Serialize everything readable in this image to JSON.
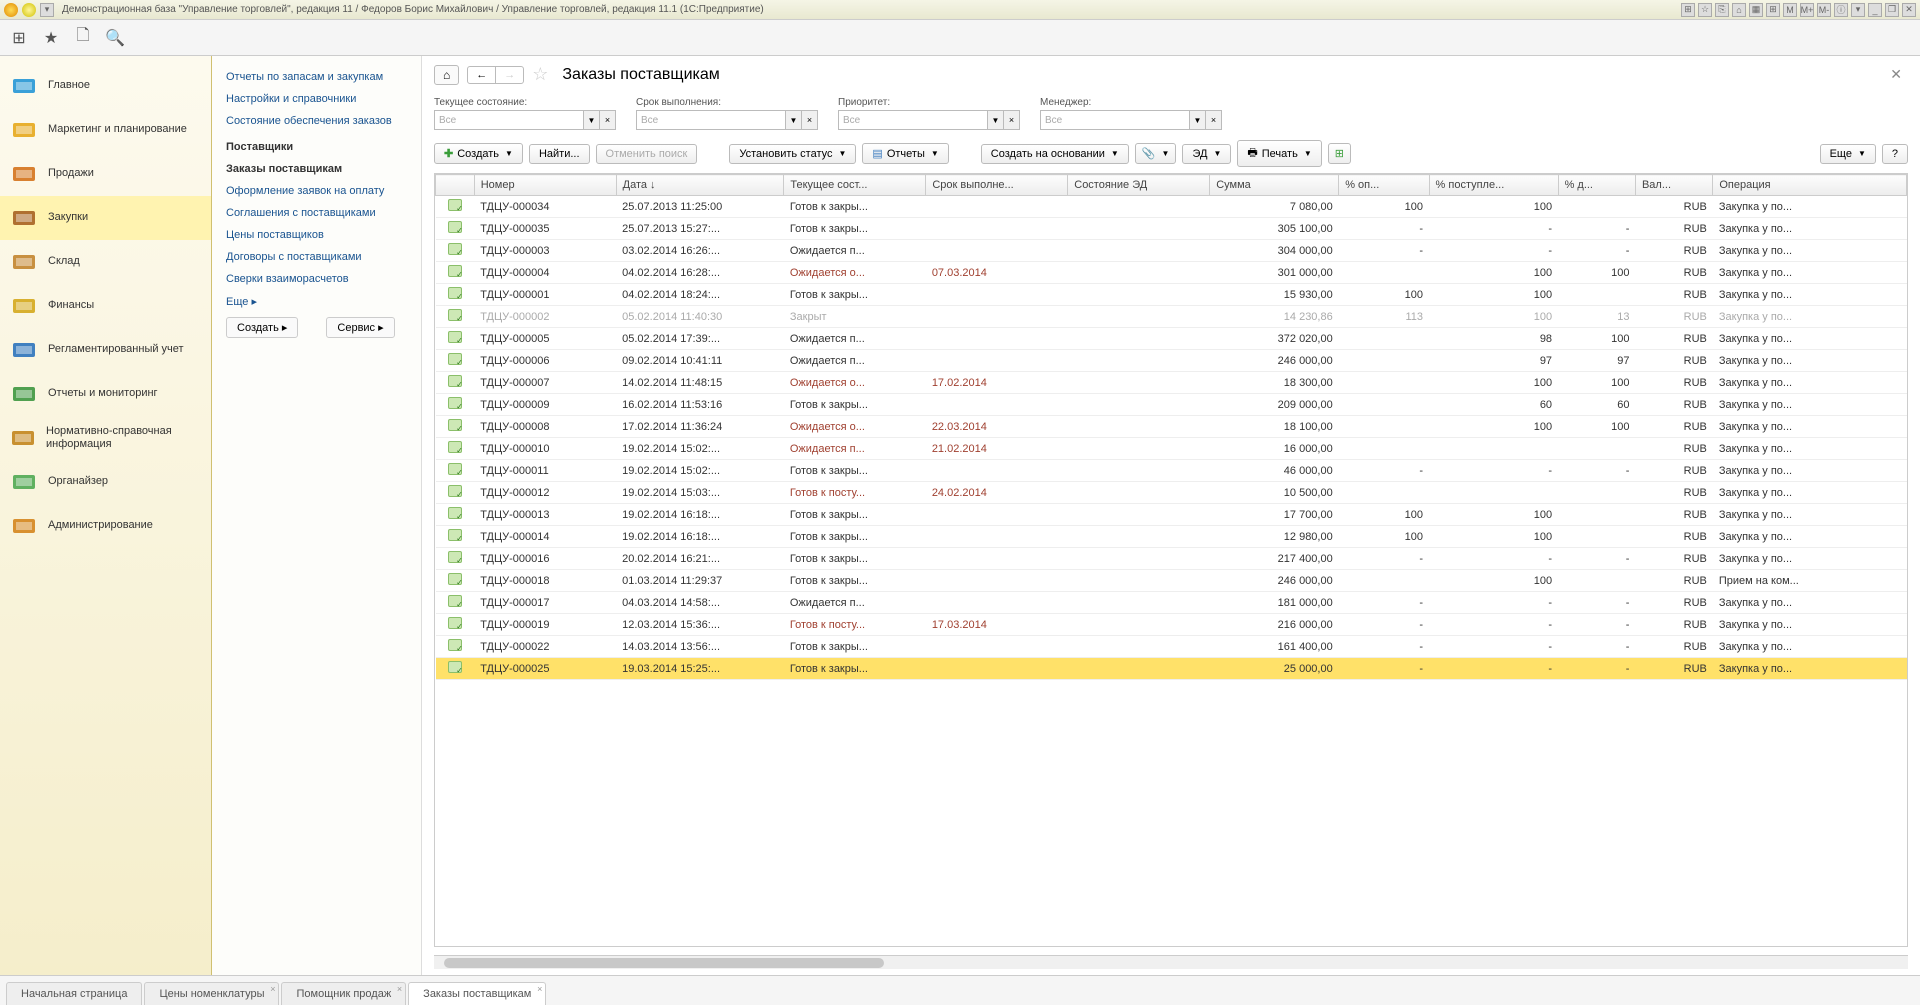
{
  "titlebar": {
    "text": "Демонстрационная база \"Управление торговлей\", редакция 11 / Федоров Борис Михайлович / Управление торговлей, редакция 11.1  (1С:Предприятие)",
    "right_icons": [
      "⊞",
      "☆",
      "⎘",
      "⌂",
      "▦",
      "⊞",
      "M",
      "M+",
      "M-",
      "ⓘ",
      "▾",
      "_",
      "❐",
      "✕"
    ]
  },
  "leftnav": [
    {
      "label": "Главное",
      "icon": "main"
    },
    {
      "label": "Маркетинг и планирование",
      "icon": "marketing"
    },
    {
      "label": "Продажи",
      "icon": "sales"
    },
    {
      "label": "Закупки",
      "icon": "purchases",
      "selected": true
    },
    {
      "label": "Склад",
      "icon": "warehouse"
    },
    {
      "label": "Финансы",
      "icon": "finance"
    },
    {
      "label": "Регламентированный учет",
      "icon": "accounting"
    },
    {
      "label": "Отчеты и мониторинг",
      "icon": "reports"
    },
    {
      "label": "Нормативно-справочная информация",
      "icon": "refinfo"
    },
    {
      "label": "Органайзер",
      "icon": "organizer"
    },
    {
      "label": "Администрирование",
      "icon": "admin"
    }
  ],
  "subnav": {
    "links": [
      {
        "text": "Отчеты по запасам и закупкам",
        "type": "link"
      },
      {
        "text": "Настройки и справочники",
        "type": "link"
      },
      {
        "text": "Состояние обеспечения заказов",
        "type": "link"
      },
      {
        "text": "Поставщики",
        "type": "title"
      },
      {
        "text": "Заказы поставщикам",
        "type": "active"
      },
      {
        "text": "Оформление заявок на оплату",
        "type": "link"
      },
      {
        "text": "Соглашения с поставщиками",
        "type": "link"
      },
      {
        "text": "Цены поставщиков",
        "type": "link"
      },
      {
        "text": "Договоры с поставщиками",
        "type": "link"
      },
      {
        "text": "Сверки взаиморасчетов",
        "type": "link"
      },
      {
        "text": "Еще ▸",
        "type": "link"
      }
    ],
    "create_btn": "Создать ▸",
    "service_btn": "Сервис ▸"
  },
  "page": {
    "title": "Заказы поставщикам",
    "filters": [
      {
        "label": "Текущее состояние:",
        "value": "Все"
      },
      {
        "label": "Срок выполнения:",
        "value": "Все"
      },
      {
        "label": "Приоритет:",
        "value": "Все"
      },
      {
        "label": "Менеджер:",
        "value": "Все"
      }
    ],
    "toolbar": {
      "create": "Создать",
      "find": "Найти...",
      "cancel_find": "Отменить поиск",
      "set_status": "Установить статус",
      "reports": "Отчеты",
      "create_based": "Создать на основании",
      "ed": "ЭД",
      "print": "Печать",
      "more": "Еще",
      "help": "?"
    },
    "columns": [
      "",
      "Номер",
      "Дата ↓",
      "Текущее сост...",
      "Срок выполне...",
      "Состояние ЭД",
      "Сумма",
      "% оп...",
      "% поступле...",
      "% д...",
      "Вал...",
      "Операция"
    ],
    "rows": [
      {
        "n": "ТДЦУ-000034",
        "d": "25.07.2013 11:25:00",
        "st": "Готов к закры...",
        "due": "",
        "ed": "",
        "sum": "7 080,00",
        "op": "100",
        "pp": "100",
        "pd": "",
        "cur": "RUB",
        "oper": "Закупка у по..."
      },
      {
        "n": "ТДЦУ-000035",
        "d": "25.07.2013 15:27:...",
        "st": "Готов к закры...",
        "due": "",
        "ed": "",
        "sum": "305 100,00",
        "op": "-",
        "pp": "-",
        "pd": "-",
        "cur": "RUB",
        "oper": "Закупка у по..."
      },
      {
        "n": "ТДЦУ-000003",
        "d": "03.02.2014 16:26:...",
        "st": "Ожидается п...",
        "due": "",
        "ed": "",
        "sum": "304 000,00",
        "op": "-",
        "pp": "-",
        "pd": "-",
        "cur": "RUB",
        "oper": "Закупка у по..."
      },
      {
        "n": "ТДЦУ-000004",
        "d": "04.02.2014 16:28:...",
        "st": "Ожидается о...",
        "due": "07.03.2014",
        "ed": "",
        "sum": "301 000,00",
        "op": "",
        "pp": "100",
        "pd": "100",
        "cur": "RUB",
        "oper": "Закупка у по...",
        "warn": true
      },
      {
        "n": "ТДЦУ-000001",
        "d": "04.02.2014 18:24:...",
        "st": "Готов к закры...",
        "due": "",
        "ed": "",
        "sum": "15 930,00",
        "op": "100",
        "pp": "100",
        "pd": "",
        "cur": "RUB",
        "oper": "Закупка у по..."
      },
      {
        "n": "ТДЦУ-000002",
        "d": "05.02.2014 11:40:30",
        "st": "Закрыт",
        "due": "",
        "ed": "",
        "sum": "14 230,86",
        "op": "113",
        "pp": "100",
        "pd": "13",
        "cur": "RUB",
        "oper": "Закупка у по...",
        "closed": true
      },
      {
        "n": "ТДЦУ-000005",
        "d": "05.02.2014 17:39:...",
        "st": "Ожидается п...",
        "due": "",
        "ed": "",
        "sum": "372 020,00",
        "op": "",
        "pp": "98",
        "pd": "100",
        "cur": "RUB",
        "oper": "Закупка у по..."
      },
      {
        "n": "ТДЦУ-000006",
        "d": "09.02.2014 10:41:11",
        "st": "Ожидается п...",
        "due": "",
        "ed": "",
        "sum": "246 000,00",
        "op": "",
        "pp": "97",
        "pd": "97",
        "cur": "RUB",
        "oper": "Закупка у по..."
      },
      {
        "n": "ТДЦУ-000007",
        "d": "14.02.2014 11:48:15",
        "st": "Ожидается о...",
        "due": "17.02.2014",
        "ed": "",
        "sum": "18 300,00",
        "op": "",
        "pp": "100",
        "pd": "100",
        "cur": "RUB",
        "oper": "Закупка у по...",
        "warn": true
      },
      {
        "n": "ТДЦУ-000009",
        "d": "16.02.2014 11:53:16",
        "st": "Готов к закры...",
        "due": "",
        "ed": "",
        "sum": "209 000,00",
        "op": "",
        "pp": "60",
        "pd": "60",
        "cur": "RUB",
        "oper": "Закупка у по..."
      },
      {
        "n": "ТДЦУ-000008",
        "d": "17.02.2014 11:36:24",
        "st": "Ожидается о...",
        "due": "22.03.2014",
        "ed": "",
        "sum": "18 100,00",
        "op": "",
        "pp": "100",
        "pd": "100",
        "cur": "RUB",
        "oper": "Закупка у по...",
        "warn": true
      },
      {
        "n": "ТДЦУ-000010",
        "d": "19.02.2014 15:02:...",
        "st": "Ожидается п...",
        "due": "21.02.2014",
        "ed": "",
        "sum": "16 000,00",
        "op": "",
        "pp": "",
        "pd": "",
        "cur": "RUB",
        "oper": "Закупка у по...",
        "warn": true
      },
      {
        "n": "ТДЦУ-000011",
        "d": "19.02.2014 15:02:...",
        "st": "Готов к закры...",
        "due": "",
        "ed": "",
        "sum": "46 000,00",
        "op": "-",
        "pp": "-",
        "pd": "-",
        "cur": "RUB",
        "oper": "Закупка у по..."
      },
      {
        "n": "ТДЦУ-000012",
        "d": "19.02.2014 15:03:...",
        "st": "Готов к посту...",
        "due": "24.02.2014",
        "ed": "",
        "sum": "10 500,00",
        "op": "",
        "pp": "",
        "pd": "",
        "cur": "RUB",
        "oper": "Закупка у по...",
        "warn": true
      },
      {
        "n": "ТДЦУ-000013",
        "d": "19.02.2014 16:18:...",
        "st": "Готов к закры...",
        "due": "",
        "ed": "",
        "sum": "17 700,00",
        "op": "100",
        "pp": "100",
        "pd": "",
        "cur": "RUB",
        "oper": "Закупка у по..."
      },
      {
        "n": "ТДЦУ-000014",
        "d": "19.02.2014 16:18:...",
        "st": "Готов к закры...",
        "due": "",
        "ed": "",
        "sum": "12 980,00",
        "op": "100",
        "pp": "100",
        "pd": "",
        "cur": "RUB",
        "oper": "Закупка у по..."
      },
      {
        "n": "ТДЦУ-000016",
        "d": "20.02.2014 16:21:...",
        "st": "Готов к закры...",
        "due": "",
        "ed": "",
        "sum": "217 400,00",
        "op": "-",
        "pp": "-",
        "pd": "-",
        "cur": "RUB",
        "oper": "Закупка у по..."
      },
      {
        "n": "ТДЦУ-000018",
        "d": "01.03.2014 11:29:37",
        "st": "Готов к закры...",
        "due": "",
        "ed": "",
        "sum": "246 000,00",
        "op": "",
        "pp": "100",
        "pd": "",
        "cur": "RUB",
        "oper": "Прием на ком..."
      },
      {
        "n": "ТДЦУ-000017",
        "d": "04.03.2014 14:58:...",
        "st": "Ожидается п...",
        "due": "",
        "ed": "",
        "sum": "181 000,00",
        "op": "-",
        "pp": "-",
        "pd": "-",
        "cur": "RUB",
        "oper": "Закупка у по..."
      },
      {
        "n": "ТДЦУ-000019",
        "d": "12.03.2014 15:36:...",
        "st": "Готов к посту...",
        "due": "17.03.2014",
        "ed": "",
        "sum": "216 000,00",
        "op": "-",
        "pp": "-",
        "pd": "-",
        "cur": "RUB",
        "oper": "Закупка у по...",
        "warn": true
      },
      {
        "n": "ТДЦУ-000022",
        "d": "14.03.2014 13:56:...",
        "st": "Готов к закры...",
        "due": "",
        "ed": "",
        "sum": "161 400,00",
        "op": "-",
        "pp": "-",
        "pd": "-",
        "cur": "RUB",
        "oper": "Закупка у по..."
      },
      {
        "n": "ТДЦУ-000025",
        "d": "19.03.2014 15:25:...",
        "st": "Готов к закры...",
        "due": "",
        "ed": "",
        "sum": "25 000,00",
        "op": "-",
        "pp": "-",
        "pd": "-",
        "cur": "RUB",
        "oper": "Закупка у по...",
        "selected": true
      }
    ]
  },
  "bottomtabs": [
    {
      "label": "Начальная страница",
      "closable": false
    },
    {
      "label": "Цены номенклатуры",
      "closable": true
    },
    {
      "label": "Помощник продаж",
      "closable": true
    },
    {
      "label": "Заказы поставщикам",
      "closable": true,
      "active": true
    }
  ]
}
